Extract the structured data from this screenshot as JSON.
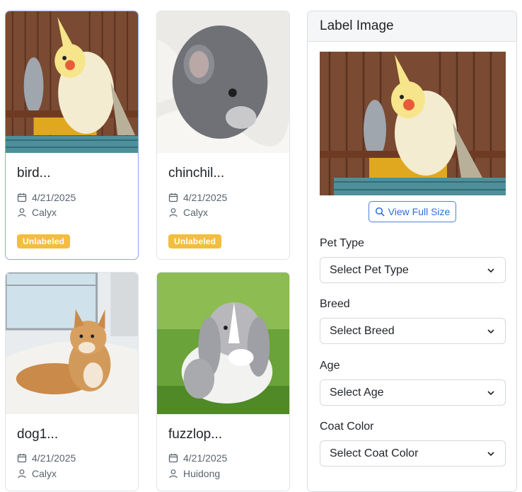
{
  "cards": [
    {
      "title": "bird...",
      "date": "4/21/2025",
      "user": "Calyx",
      "badge": "Unlabeled"
    },
    {
      "title": "chinchil...",
      "date": "4/21/2025",
      "user": "Calyx",
      "badge": "Unlabeled"
    },
    {
      "title": "dog1...",
      "date": "4/21/2025",
      "user": "Calyx"
    },
    {
      "title": "fuzzlop...",
      "date": "4/21/2025",
      "user": "Huidong"
    }
  ],
  "panel": {
    "title": "Label Image",
    "view_full_size": "View Full Size",
    "fields": [
      {
        "label": "Pet Type",
        "placeholder": "Select Pet Type"
      },
      {
        "label": "Breed",
        "placeholder": "Select Breed"
      },
      {
        "label": "Age",
        "placeholder": "Select Age"
      },
      {
        "label": "Coat Color",
        "placeholder": "Select Coat Color"
      }
    ]
  },
  "icons": [
    "calendar-icon",
    "user-icon",
    "search-icon",
    "chevron-down-icon"
  ],
  "colors": {
    "badge": "#f3bd3d",
    "accent": "#2f6ce0",
    "selected_border": "#8aa8e6"
  }
}
